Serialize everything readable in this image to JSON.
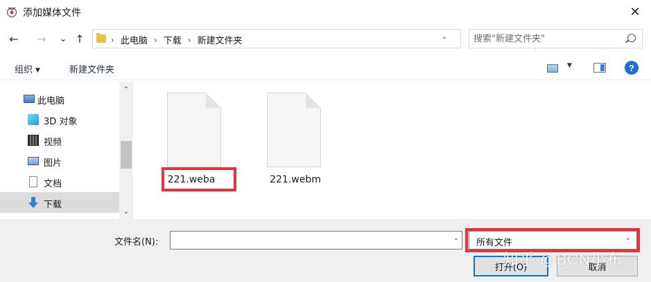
{
  "window": {
    "title": "添加媒体文件",
    "close_glyph": "✕"
  },
  "nav": {
    "back": "←",
    "forward": "→",
    "recent": "⌄",
    "up": "↑",
    "refresh": "↻"
  },
  "address": {
    "crumbs": [
      "此电脑",
      "下载",
      "新建文件夹"
    ],
    "sep": "›",
    "dropdown": "⌄"
  },
  "search": {
    "placeholder": "搜索\"新建文件夹\"",
    "value": ""
  },
  "toolbar": {
    "organize": "组织",
    "organize_caret": "▼",
    "new_folder": "新建文件夹",
    "view_caret": "▼",
    "help": "?"
  },
  "sidebar": {
    "items": [
      {
        "label": "此电脑",
        "icon": "pc-icon"
      },
      {
        "label": "3D 对象",
        "icon": "cube-icon"
      },
      {
        "label": "视频",
        "icon": "video-icon"
      },
      {
        "label": "图片",
        "icon": "picture-icon"
      },
      {
        "label": "文档",
        "icon": "document-icon"
      },
      {
        "label": "下载",
        "icon": "download-icon",
        "selected": true
      }
    ],
    "scroll_up": "⌃",
    "scroll_down": "⌄"
  },
  "files": [
    {
      "name": "221.weba",
      "highlighted": true
    },
    {
      "name": "221.webm",
      "highlighted": false
    }
  ],
  "footer": {
    "filename_label": "文件名(N):",
    "filename_value": "",
    "filename_dd": "⌄",
    "filter_value": "所有文件",
    "filter_dd": "⌄",
    "open_label": "打开(O)",
    "cancel_label": "取消",
    "watermark": "知乎 @BCN小布"
  },
  "colors": {
    "highlight": "#e5323c",
    "accent": "#0078d7"
  }
}
